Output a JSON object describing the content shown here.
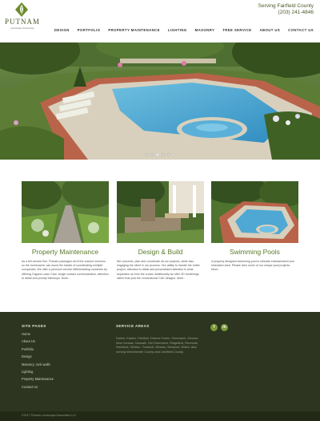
{
  "header": {
    "logo_name": "PUTNAM",
    "logo_sub": "Landscape Associates",
    "serving": "Serving Fairfield County",
    "phone": "(203) 241-4846",
    "nav": [
      "DESIGN",
      "PORTFOLIO",
      "PROPERTY MAINTENANCE",
      "LIGHTING",
      "MASONRY",
      "TREE SERVICE",
      "ABOUT US",
      "CONTACT US"
    ]
  },
  "hero": {
    "slides_count": 5,
    "active_slide": 3
  },
  "cards": [
    {
      "title": "Property Maintenance",
      "text": "As a full service firm, Putnam packages all of the outdoor services so the homeowner can avoid the hassle of coordinating multiple companies. We offer a premium service differentiating ourselves by offering Organic Lawn Care, single contact communication, attention to detail and prompt followups. More..."
    },
    {
      "title": "Design & Build",
      "text": "We conceive, plan and coordinate all our projects, while also engaging the client in our process. Our ability to handle the entire project, attention to detail and personalized attention is what separates us from the crowd. Additionally we offer 3D renderings rather than just the conventional CAD designs. More..."
    },
    {
      "title": "Swimming Pools",
      "text": "A properly designed swimming pool is ultimate entertainment and relaxation area. Please view some of our unique pool projects. More..."
    }
  ],
  "footer": {
    "site_pages_heading": "SITE PAGES",
    "site_pages": [
      "Home",
      "About Us",
      "Portfolio",
      "Design",
      "Masonry, rock walls",
      "Lighting",
      "Property Maintenance",
      "Contact Us"
    ],
    "service_heading": "SERVICE AREAS",
    "service_text": "Darien, Easton, Fairfield, Greens Farms, Greenwich, Monroe, New Canaan, Norwalk, Old Greenwich, Ridgefield, Riverside, Stamford, Shelton, Trumbull, Weston, Westport, Wilton. Also serving Westchester County and Litchfield County.",
    "social": [
      "f",
      "in"
    ],
    "copyright": "©2017 Putnam Landscape Associates LLC"
  }
}
